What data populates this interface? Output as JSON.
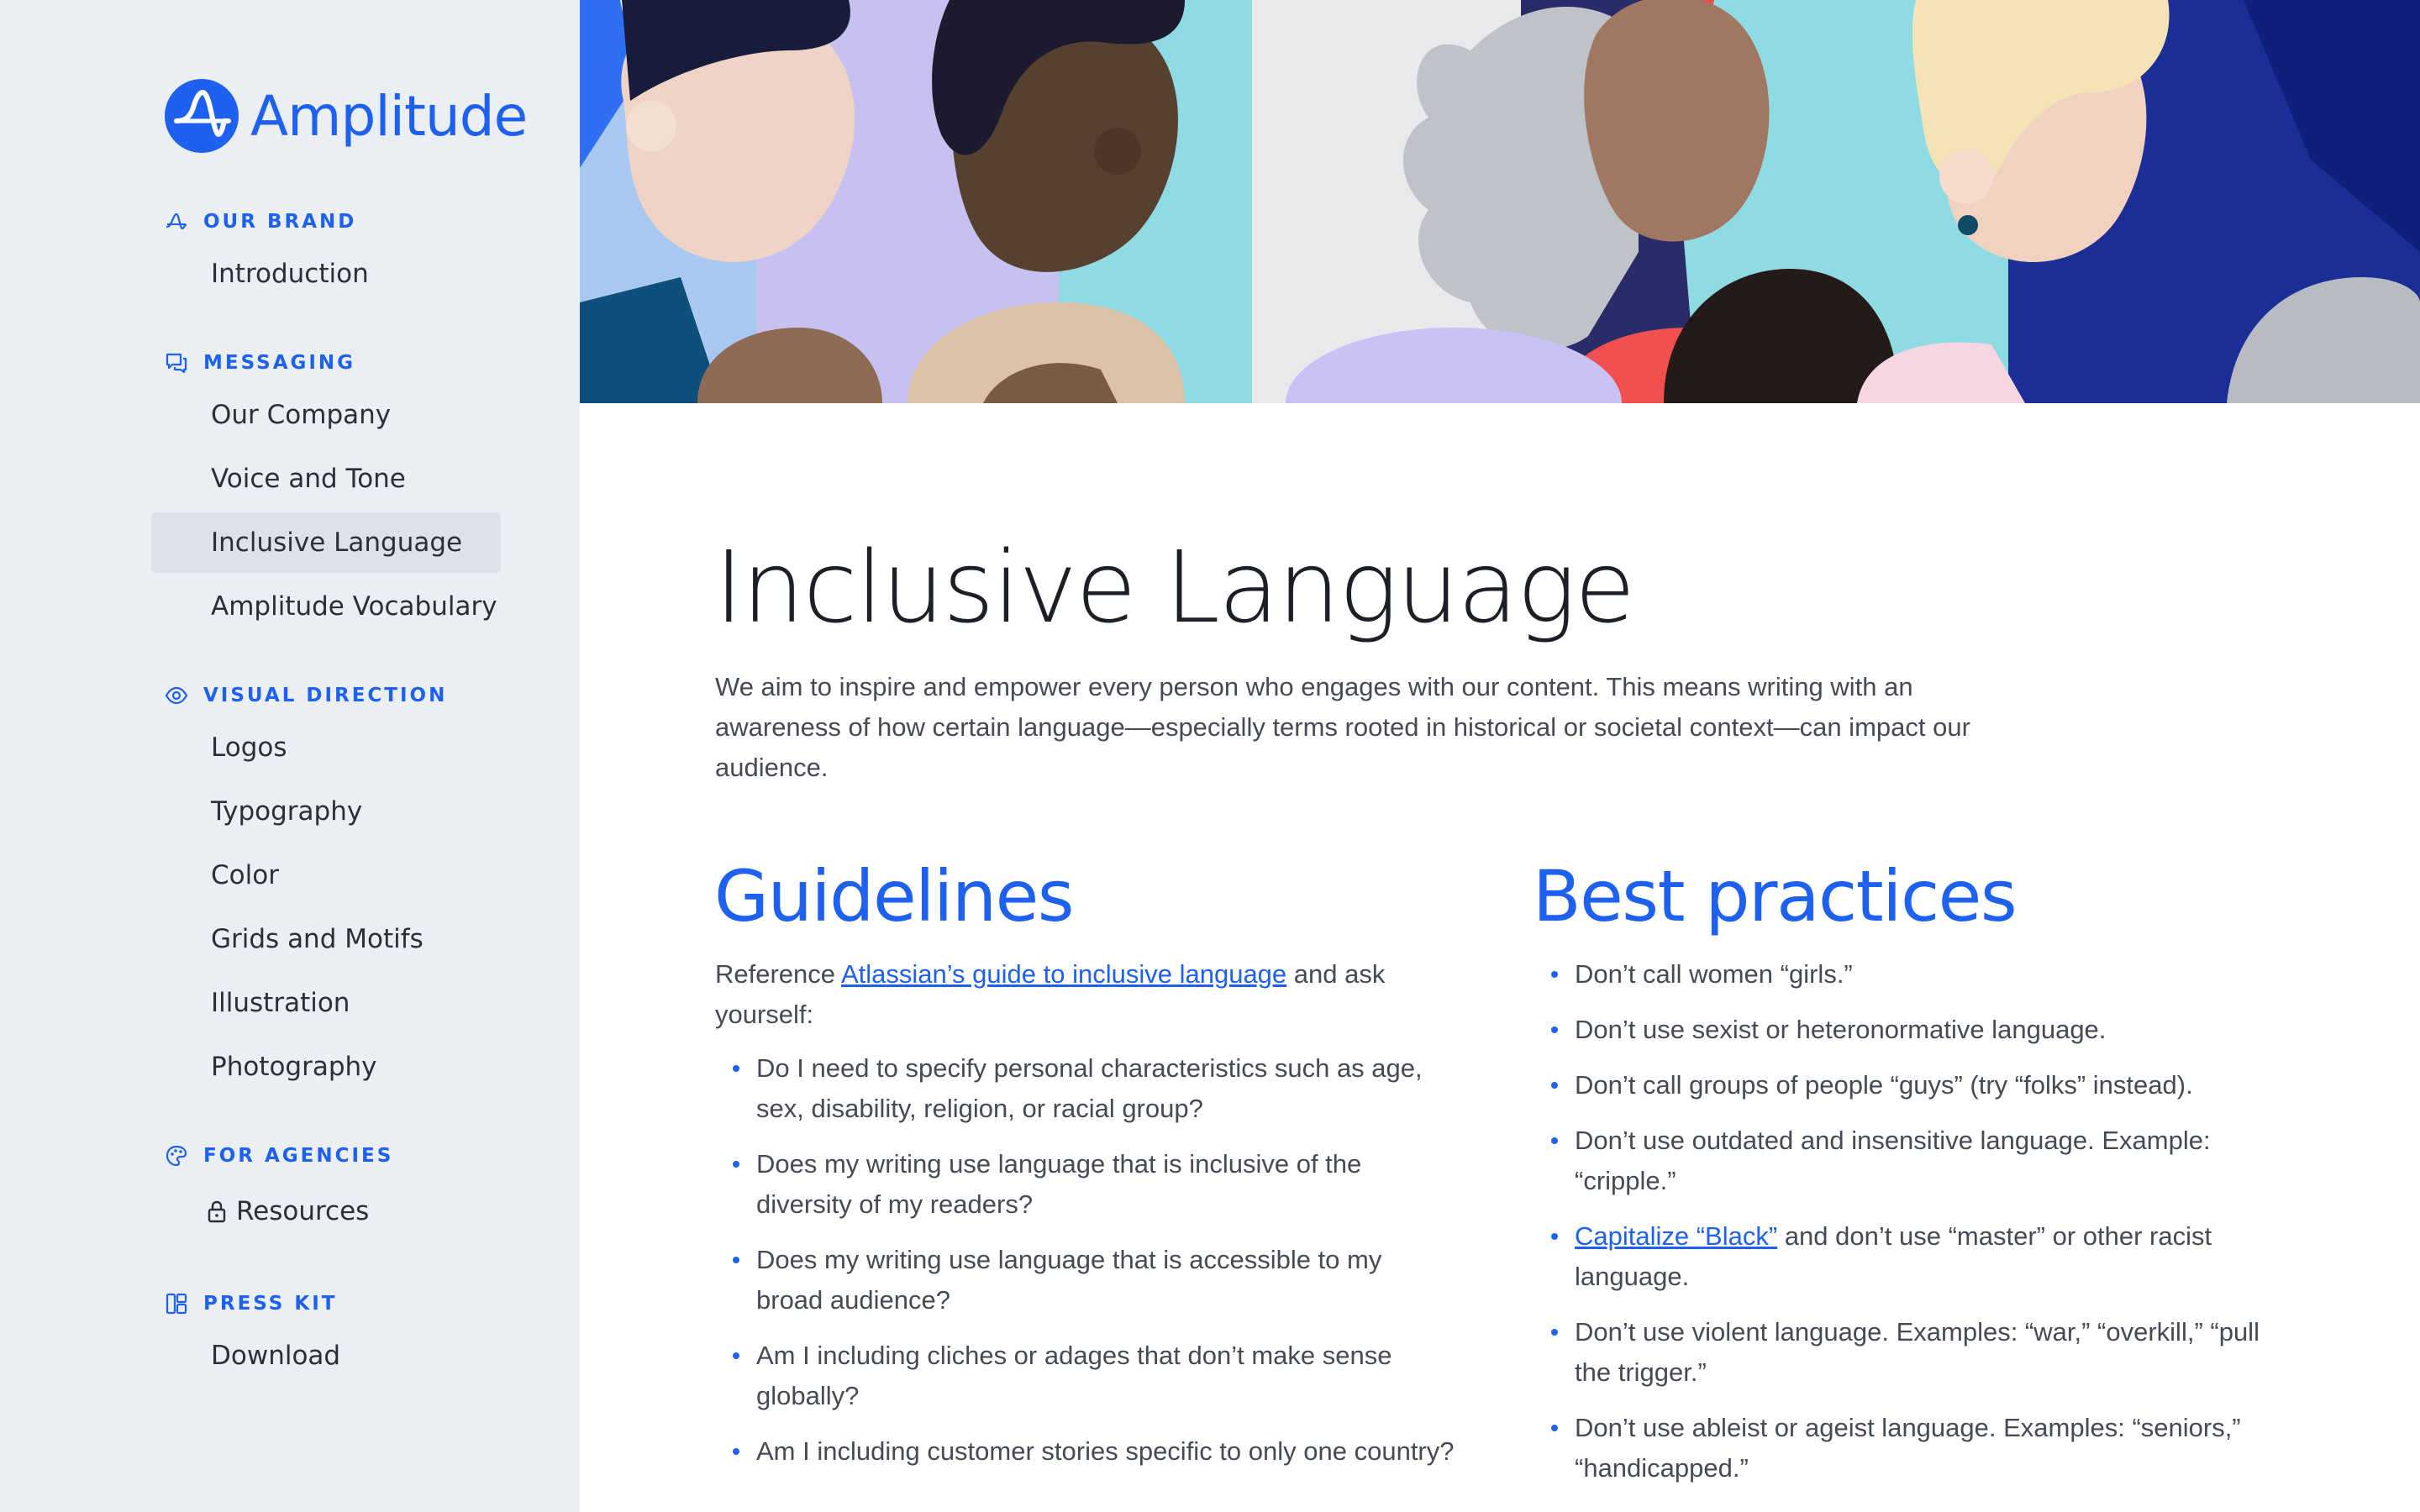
{
  "brand": {
    "name": "Amplitude",
    "accent": "#1e61f0"
  },
  "sidebar": {
    "sections": [
      {
        "label": "OUR BRAND",
        "icon": "amplitude-glyph-icon",
        "items": [
          {
            "label": "Introduction"
          }
        ]
      },
      {
        "label": "MESSAGING",
        "icon": "chat-icon",
        "items": [
          {
            "label": "Our Company"
          },
          {
            "label": "Voice and Tone"
          },
          {
            "label": "Inclusive Language",
            "active": true
          },
          {
            "label": "Amplitude Vocabulary"
          }
        ]
      },
      {
        "label": "VISUAL DIRECTION",
        "icon": "eye-icon",
        "items": [
          {
            "label": "Logos"
          },
          {
            "label": "Typography"
          },
          {
            "label": "Color"
          },
          {
            "label": "Grids and Motifs"
          },
          {
            "label": "Illustration"
          },
          {
            "label": "Photography"
          }
        ]
      },
      {
        "label": "FOR AGENCIES",
        "icon": "palette-icon",
        "items": [
          {
            "label": "Resources",
            "icon": "lock-icon"
          }
        ]
      },
      {
        "label": "PRESS KIT",
        "icon": "layout-icon",
        "items": [
          {
            "label": "Download"
          }
        ]
      }
    ]
  },
  "page": {
    "title": "Inclusive Language",
    "intro": "We aim to inspire and empower every person who engages with our content. This means writing with an awareness of how certain language—especially terms rooted in historical or societal context—can impact our audience."
  },
  "guidelines": {
    "title": "Guidelines",
    "lead_prefix": "Reference ",
    "lead_link": "Atlassian’s guide to inclusive language",
    "lead_suffix": " and ask yourself:",
    "items": [
      "Do I need to specify personal characteristics such as age, sex, disability, religion, or racial group?",
      "Does my writing use language that is inclusive of the diversity of my readers?",
      "Does my writing use language that is accessible to my broad audience?",
      "Am I including cliches or adages that don’t make sense globally?",
      "Am I including customer stories specific to only one country?"
    ]
  },
  "best_practices": {
    "title": "Best practices",
    "items": [
      "Don’t call women “girls.”",
      "Don’t use sexist or heteronormative language.",
      "Don’t call groups of people “guys” (try “folks” instead).",
      "Don’t use outdated and insensitive language. Example: “cripple.”",
      "Don’t use violent language. Examples: “war,” “overkill,” “pull the trigger.”",
      "Don’t use ableist or ageist language. Examples: “seniors,” “handicapped.”"
    ],
    "link_item": {
      "link": "Capitalize “Black”",
      "suffix": " and don’t use “master” or other racist language."
    }
  }
}
